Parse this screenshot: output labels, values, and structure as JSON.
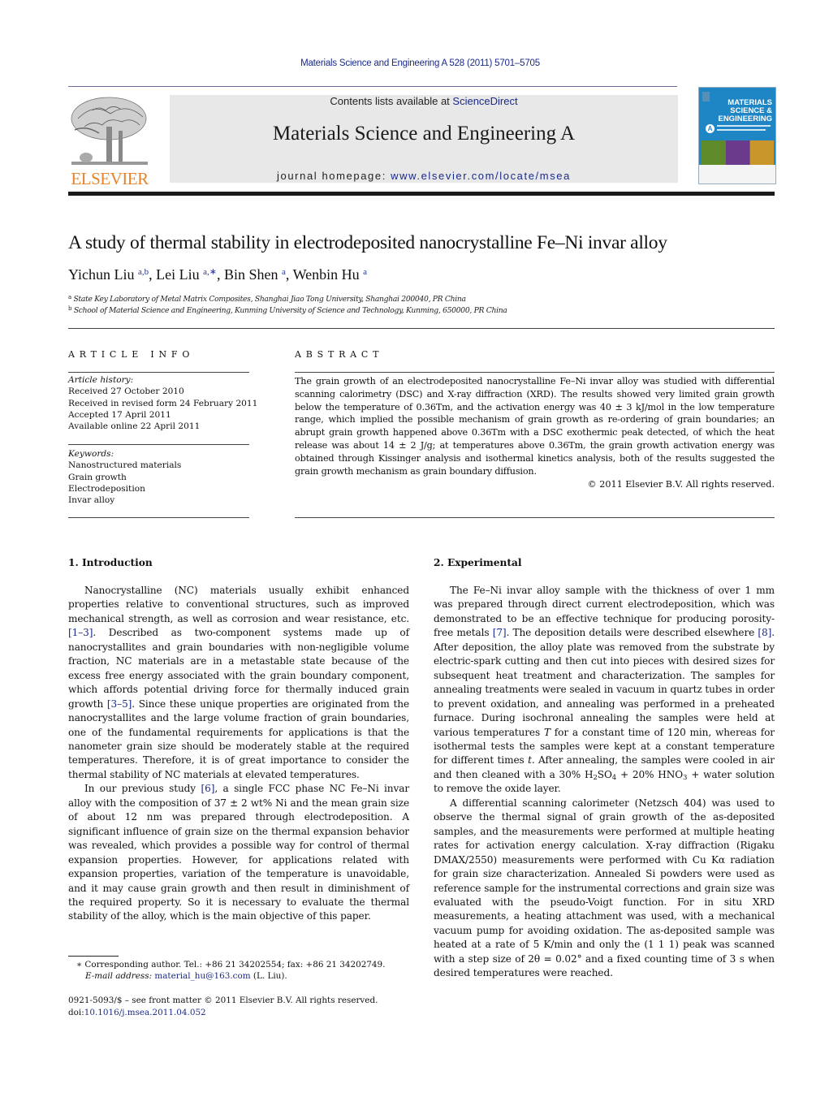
{
  "header": {
    "citation": "Materials Science and Engineering A 528 (2011) 5701–5705",
    "contents_prefix": "Contents lists available at ",
    "contents_link": "ScienceDirect",
    "journal_name": "Materials Science and Engineering A",
    "homepage_prefix": "journal homepage: ",
    "homepage_link": "www.elsevier.com/locate/msea",
    "publisher_logo_text": "ELSEVIER",
    "cover": {
      "title_lines": [
        "MATERIALS",
        "SCIENCE &",
        "ENGINEERING"
      ],
      "series_letter": "A",
      "colors": {
        "background": "#1f86c6",
        "image_1": "#5f8a2a",
        "image_2": "#6a3b8c",
        "image_3": "#c8962a"
      }
    },
    "colors": {
      "link": "#1a2a8a",
      "elsevier_orange": "#e7832a",
      "banner_bg": "#e8e8e8"
    }
  },
  "article": {
    "title": "A study of thermal stability in electrodeposited nanocrystalline Fe–Ni invar alloy",
    "authors": [
      {
        "name": "Yichun Liu",
        "affil": "a,b"
      },
      {
        "name": "Lei Liu",
        "affil": "a,∗"
      },
      {
        "name": "Bin Shen",
        "affil": "a"
      },
      {
        "name": "Wenbin Hu",
        "affil": "a"
      }
    ],
    "affiliations": [
      {
        "key": "a",
        "text": "State Key Laboratory of Metal Matrix Composites, Shanghai Jiao Tong University, Shanghai 200040, PR China"
      },
      {
        "key": "b",
        "text": "School of Material Science and Engineering, Kunming University of Science and Technology, Kunming, 650000, PR China"
      }
    ]
  },
  "article_info": {
    "heading": "ARTICLE INFO",
    "history_label": "Article history:",
    "history": [
      "Received 27 October 2010",
      "Received in revised form 24 February 2011",
      "Accepted 17 April 2011",
      "Available online 22 April 2011"
    ],
    "keywords_label": "Keywords:",
    "keywords": [
      "Nanostructured materials",
      "Grain growth",
      "Electrodeposition",
      "Invar alloy"
    ]
  },
  "abstract": {
    "heading": "ABSTRACT",
    "text": "The grain growth of an electrodeposited nanocrystalline Fe–Ni invar alloy was studied with differential scanning calorimetry (DSC) and X-ray diffraction (XRD). The results showed very limited grain growth below the temperature of 0.36Tm, and the activation energy was 40 ± 3 kJ/mol in the low temperature range, which implied the possible mechanism of grain growth as re-ordering of grain boundaries; an abrupt grain growth happened above 0.36Tm with a DSC exothermic peak detected, of which the heat release was about 14 ± 2 J/g; at temperatures above 0.36Tm, the grain growth activation energy was obtained through Kissinger analysis and isothermal kinetics analysis, both of the results suggested the grain growth mechanism as grain boundary diffusion.",
    "copyright": "© 2011 Elsevier B.V. All rights reserved."
  },
  "sections": {
    "intro": {
      "heading": "1.  Introduction",
      "p1": [
        "Nanocrystalline (NC) materials usually exhibit enhanced properties relative to conventional structures, such as improved mechanical strength, as well as corrosion and wear resistance, etc. ",
        "[1–3]",
        ". Described as two-component systems made up of nanocrystallites and grain boundaries with non-negligible volume fraction, NC materials are in a metastable state because of the excess free energy associated with the grain boundary component, which affords potential driving force for thermally induced grain growth ",
        "[3–5]",
        ". Since these unique properties are originated from the nanocrystallites and the large volume fraction of grain boundaries, one of the fundamental requirements for applications is that the nanometer grain size should be moderately stable at the required temperatures. Therefore, it is of great importance to consider the thermal stability of NC materials at elevated temperatures."
      ],
      "p2": [
        "In our previous study ",
        "[6]",
        ", a single FCC phase NC Fe–Ni invar alloy with the composition of 37 ± 2 wt% Ni and the mean grain size of about 12 nm was prepared through electrodeposition. A significant influence of grain size on the thermal expansion behavior was revealed, which provides a possible way for control of thermal expansion properties. However, for applications related with expansion properties, variation of the temperature is unavoidable, and it may cause grain growth and then result in diminishment of the required property. So it is necessary to evaluate the thermal stability of the alloy, which is the main objective of this paper."
      ]
    },
    "experimental": {
      "heading": "2.  Experimental",
      "p1": [
        "The Fe–Ni invar alloy sample with the thickness of over 1 mm was prepared through direct current electrodeposition, which was demonstrated to be an effective technique for producing porosity-free metals ",
        "[7]",
        ". The deposition details were described elsewhere ",
        "[8]",
        ". After deposition, the alloy plate was removed from the substrate by electric-spark cutting and then cut into pieces with desired sizes for subsequent heat treatment and characterization. The samples for annealing treatments were sealed in vacuum in quartz tubes in order to prevent oxidation, and annealing was performed in a preheated furnace. During isochronal annealing the samples were held at various temperatures ",
        "T",
        " for a constant time of 120 min, whereas for isothermal tests the samples were kept at a constant temperature for different times ",
        "t",
        ". After annealing, the samples were cooled in air and then cleaned with a 30% H",
        "2",
        "SO",
        "4",
        " + 20% HNO",
        "3",
        " + water solution to remove the oxide layer."
      ],
      "p2": "A differential scanning calorimeter (Netzsch 404) was used to observe the thermal signal of grain growth of the as-deposited samples, and the measurements were performed at multiple heating rates for activation energy calculation. X-ray diffraction (Rigaku DMAX/2550) measurements were performed with Cu Kα radiation for grain size characterization. Annealed Si powders were used as reference sample for the instrumental corrections and grain size was evaluated with the pseudo-Voigt function. For in situ XRD measurements, a heating attachment was used, with a mechanical vacuum pump for avoiding oxidation. The as-deposited sample was heated at a rate of 5 K/min and only the (1 1 1) peak was scanned with a step size of 2θ = 0.02° and a fixed counting time of 3 s when desired temperatures were reached."
    }
  },
  "footnotes": {
    "corresponding": "∗  Corresponding author. Tel.: +86 21 34202554; fax: +86 21 34202749.",
    "email_label": "E-mail address: ",
    "email": "material_hu@163.com",
    "email_suffix": " (L. Liu).",
    "front_matter": "0921-5093/$ – see front matter © 2011 Elsevier B.V. All rights reserved.",
    "doi_prefix": "doi:",
    "doi": "10.1016/j.msea.2011.04.052"
  }
}
